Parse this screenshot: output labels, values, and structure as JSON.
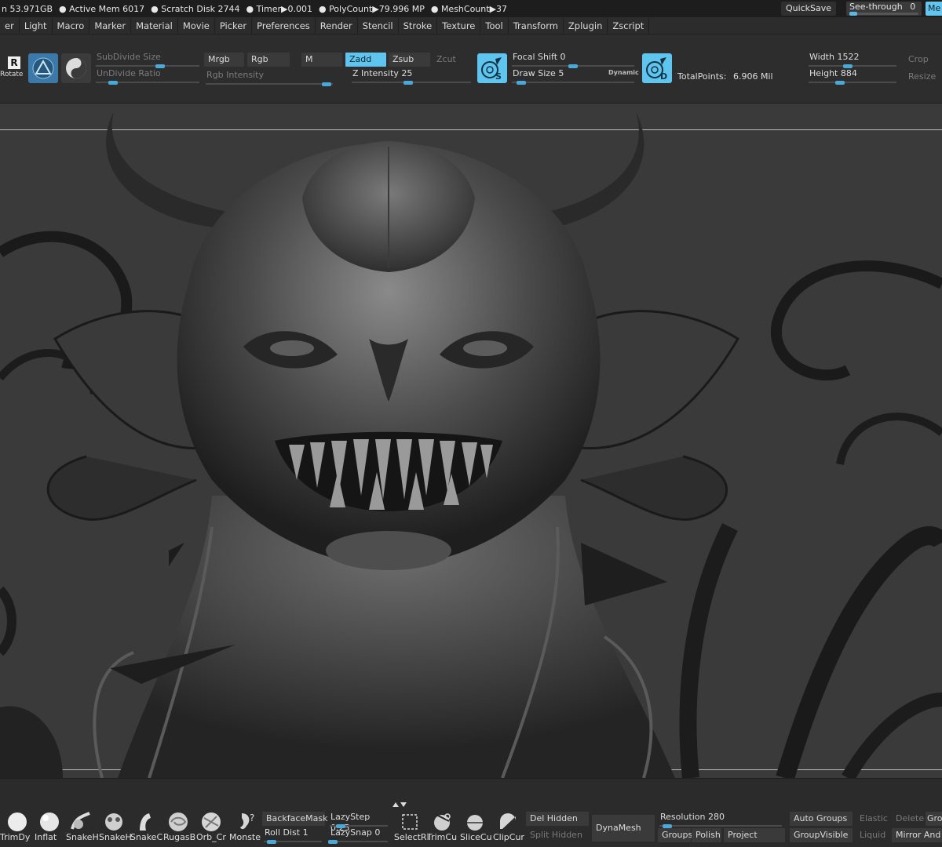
{
  "statusbar": {
    "stats": [
      "n 53.971GB",
      "● Active Mem 6017",
      "● Scratch Disk 2744",
      "● Timer▶0.001",
      "● PolyCount▶79.996 MP",
      "● MeshCount▶37"
    ],
    "quicksave": "QuickSave",
    "seethrough_label": "See-through",
    "seethrough_value": "0",
    "seethrough_level": 0,
    "menu_button": "Me"
  },
  "menubar": {
    "items": [
      "er",
      "Light",
      "Macro",
      "Marker",
      "Material",
      "Movie",
      "Picker",
      "Preferences",
      "Render",
      "Stencil",
      "Stroke",
      "Texture",
      "Tool",
      "Transform",
      "Zplugin",
      "Zscript"
    ]
  },
  "toolbar": {
    "rotate_label": "Rotate",
    "rotate_glyph": "R",
    "subdivide_size": "SubDivide Size",
    "undivide_ratio": "UnDivide Ratio",
    "mrgb": "Mrgb",
    "rgb": "Rgb",
    "rgb_intensity": "Rgb Intensity",
    "m": "M",
    "zadd": "Zadd",
    "zsub": "Zsub",
    "zcut": "Zcut",
    "z_intensity_label": "Z Intensity",
    "z_intensity_value": "25",
    "focal_shift_label": "Focal Shift",
    "focal_shift_value": "0",
    "draw_size_label": "Draw Size",
    "draw_size_value": "5",
    "dynamic": "Dynamic",
    "icon_s_letter": "S",
    "icon_d_letter": "D",
    "total_points_label": "TotalPoints:",
    "total_points_value": "6.906 Mil",
    "width_label": "Width",
    "width_value": "1522",
    "height_label": "Height",
    "height_value": "884",
    "crop": "Crop",
    "resize": "Resize"
  },
  "shelf": {
    "brushes": [
      "TrimDy",
      "Inflat",
      "SnakeH",
      "SnakeH",
      "SnakeC",
      "RugasB",
      "Orb_Cr",
      "Monste"
    ],
    "backface_mask": "BackfaceMask",
    "roll_dist_label": "Roll Dist",
    "roll_dist_value": "1",
    "lazystep_label": "LazyStep",
    "lazystep_value": "0.25",
    "lazysnap_label": "LazySnap",
    "lazysnap_value": "0",
    "tools": [
      "SelectRi",
      "TrimCu",
      "SliceCu",
      "ClipCur"
    ],
    "del_hidden": "Del Hidden",
    "split_hidden": "Split Hidden",
    "dynamesh": "DynaMesh",
    "resolution_label": "Resolution",
    "resolution_value": "280",
    "groups": "Groups",
    "polish": "Polish",
    "project": "Project",
    "auto_groups": "Auto Groups",
    "elastic": "Elastic",
    "delete": "Delete",
    "gro": "Gro",
    "group_visible": "GroupVisible",
    "liquid": "Liquid",
    "mirror_and": "Mirror And"
  }
}
